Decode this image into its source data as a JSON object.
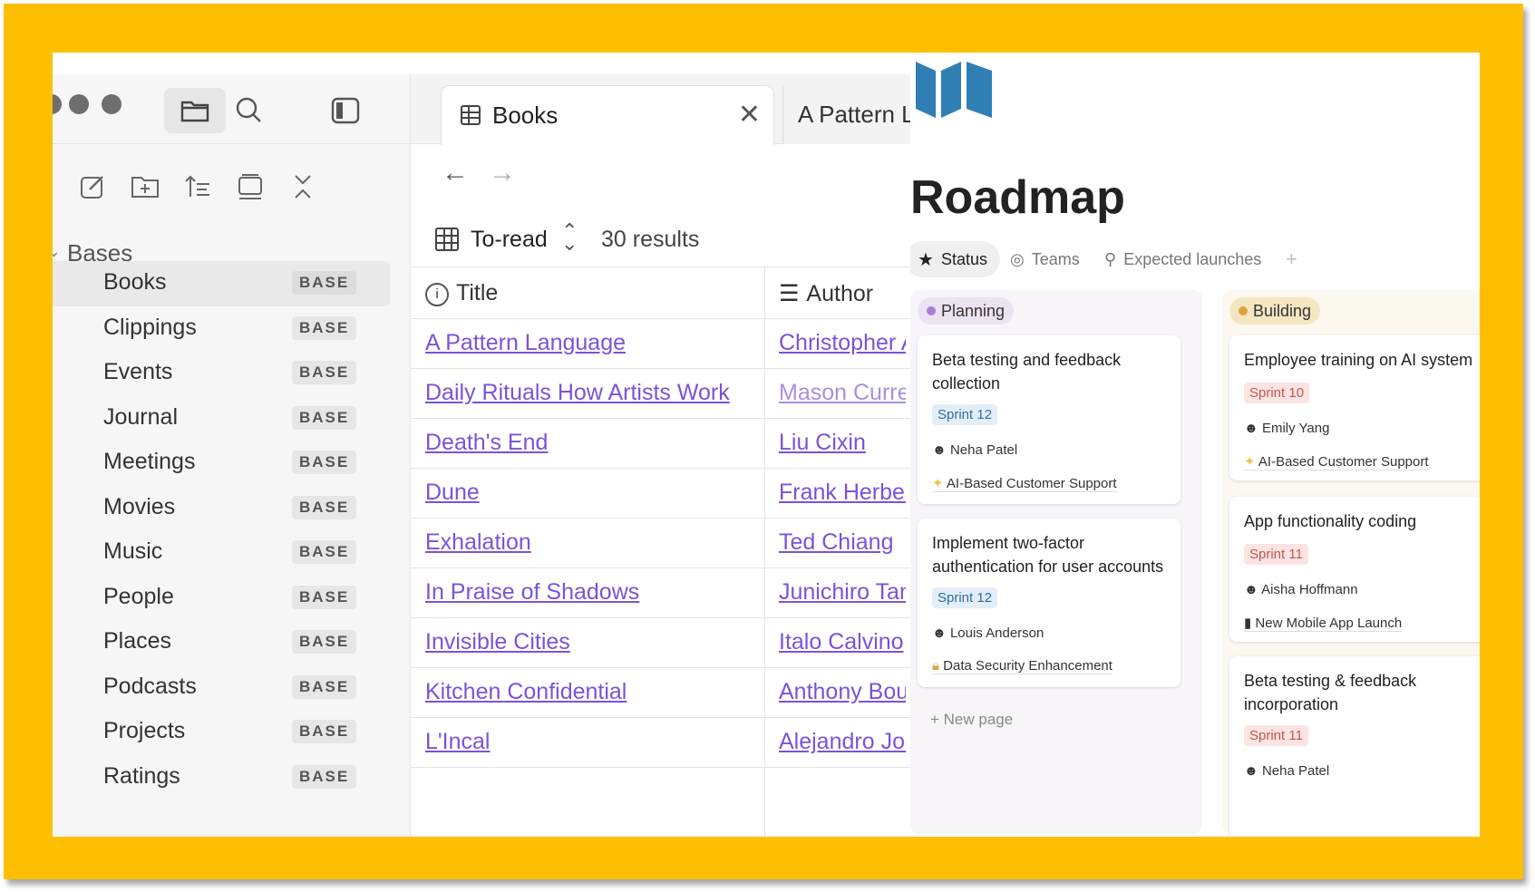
{
  "obsidian": {
    "sidebar": {
      "section_label": "Bases",
      "items": [
        {
          "label": "Books",
          "badge": "BASE"
        },
        {
          "label": "Clippings",
          "badge": "BASE"
        },
        {
          "label": "Events",
          "badge": "BASE"
        },
        {
          "label": "Journal",
          "badge": "BASE"
        },
        {
          "label": "Meetings",
          "badge": "BASE"
        },
        {
          "label": "Movies",
          "badge": "BASE"
        },
        {
          "label": "Music",
          "badge": "BASE"
        },
        {
          "label": "People",
          "badge": "BASE"
        },
        {
          "label": "Places",
          "badge": "BASE"
        },
        {
          "label": "Podcasts",
          "badge": "BASE"
        },
        {
          "label": "Projects",
          "badge": "BASE"
        },
        {
          "label": "Ratings",
          "badge": "BASE"
        }
      ]
    },
    "tabs": {
      "active": "Books",
      "next": "A Pattern Language"
    },
    "view": {
      "name": "To-read",
      "results": "30 results"
    },
    "table": {
      "columns": [
        "Title",
        "Author"
      ],
      "rows": [
        [
          "A Pattern Language",
          "Christopher Alexander"
        ],
        [
          "Daily Rituals How Artists Work",
          "Mason Currey"
        ],
        [
          "Death's End",
          "Liu Cixin"
        ],
        [
          "Dune",
          "Frank Herbert"
        ],
        [
          "Exhalation",
          "Ted Chiang"
        ],
        [
          "In Praise of Shadows",
          "Junichiro Tanizaki"
        ],
        [
          "Invisible Cities",
          "Italo Calvino"
        ],
        [
          "Kitchen Confidential",
          "Anthony Bourdain"
        ],
        [
          "L'Incal",
          "Alejandro Jodorowsky"
        ]
      ]
    }
  },
  "notion": {
    "title": "Roadmap",
    "view_tabs": [
      "Status",
      "Teams",
      "Expected launches"
    ],
    "new_page": "New page",
    "columns": {
      "planning": {
        "label": "Planning",
        "cards": [
          {
            "title": "Beta testing and feedback collection",
            "sprint": "Sprint 12",
            "person": "Neha Patel",
            "project": "AI-Based Customer Support"
          },
          {
            "title": "Implement two-factor authentication for user accounts",
            "sprint": "Sprint 12",
            "person": "Louis Anderson",
            "project": "Data Security Enhancement"
          }
        ]
      },
      "building": {
        "label": "Building",
        "cards": [
          {
            "title": "Employee training on AI system",
            "sprint": "Sprint 10",
            "person": "Emily Yang",
            "project": "AI-Based Customer Support"
          },
          {
            "title": "App functionality coding",
            "sprint": "Sprint 11",
            "person": "Aisha Hoffmann",
            "project": "New Mobile App Launch"
          },
          {
            "title": "Beta testing & feedback incorporation",
            "sprint": "Sprint 11",
            "person": "Neha Patel",
            "project": ""
          }
        ]
      }
    }
  },
  "colors": {
    "frame": "#FFBF00",
    "link": "#7b52d9",
    "logo": "#2f7fb5"
  }
}
